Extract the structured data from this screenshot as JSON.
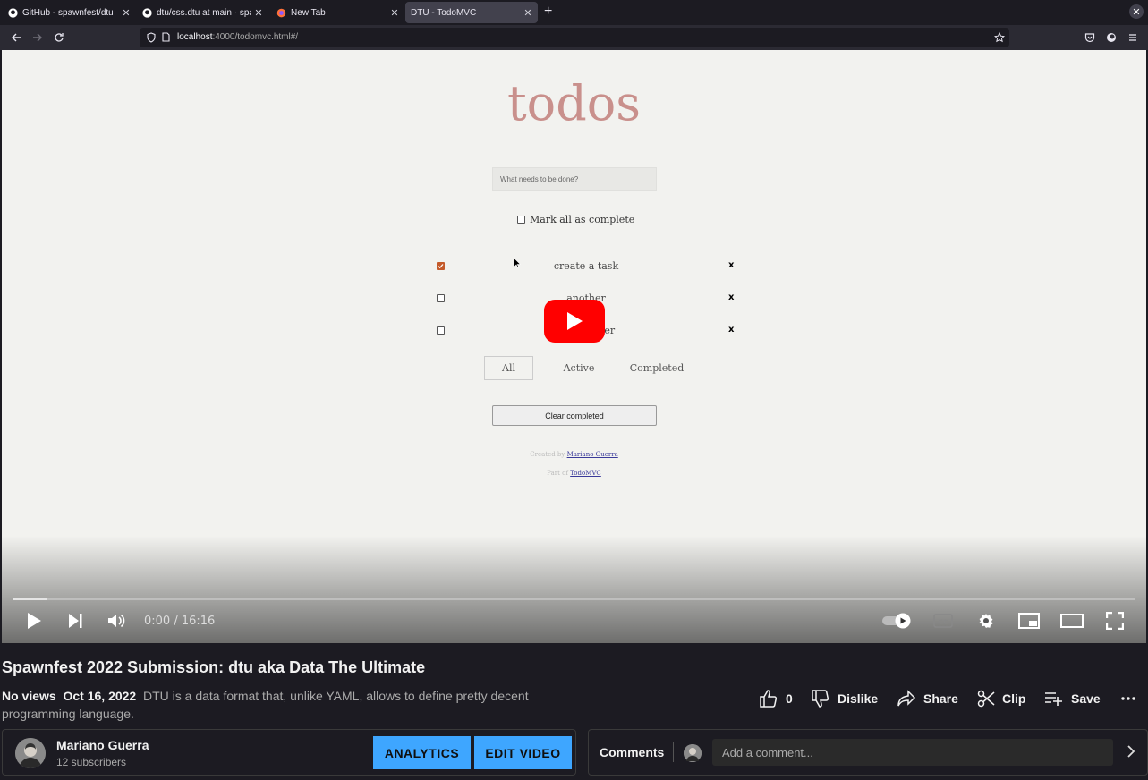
{
  "browser": {
    "tabs": [
      {
        "label": "GitHub - spawnfest/dtu",
        "icon": "github-icon"
      },
      {
        "label": "dtu/css.dtu at main · spawnfest",
        "icon": "github-icon"
      },
      {
        "label": "New Tab",
        "icon": "firefox-icon"
      },
      {
        "label": "DTU - TodoMVC",
        "icon": ""
      }
    ],
    "url_host": "localhost",
    "url_rest": ":4000/todomvc.html#/"
  },
  "app": {
    "title": "todos",
    "new_todo_placeholder": "What needs to be done?",
    "mark_all_label": "Mark all as complete",
    "todos": [
      {
        "label": "create a task",
        "done": true,
        "delete": "x"
      },
      {
        "label": "another",
        "done": false,
        "delete": "x"
      },
      {
        "label": "yet another",
        "done": false,
        "delete": "x"
      }
    ],
    "filters": [
      "All",
      "Active",
      "Completed"
    ],
    "selected_filter": "All",
    "clear_completed": "Clear completed",
    "credit_prefix": "Created by ",
    "credit_author": "Mariano Guerra",
    "part_prefix": "Part of ",
    "part_link": "TodoMVC"
  },
  "player": {
    "time": "0:00 / 16:16",
    "progress_buffered": 0.03,
    "autoplay_on": true
  },
  "video": {
    "title": "Spawnfest 2022 Submission: dtu aka Data The Ultimate",
    "views": "No views",
    "date": "Oct 16, 2022",
    "description": "DTU is a data format that, unlike YAML, allows to define pretty decent programming language.",
    "likes": "0",
    "dislike_label": "Dislike",
    "share_label": "Share",
    "clip_label": "Clip",
    "save_label": "Save"
  },
  "channel": {
    "name": "Mariano Guerra",
    "subscribers": "12 subscribers",
    "analytics_label": "ANALYTICS",
    "edit_label": "EDIT VIDEO"
  },
  "comments": {
    "label": "Comments",
    "placeholder": "Add a comment..."
  },
  "colors": {
    "youtube_red": "#ff0000",
    "action_blue": "#3ea6ff",
    "todo_title": "#c9908c"
  }
}
